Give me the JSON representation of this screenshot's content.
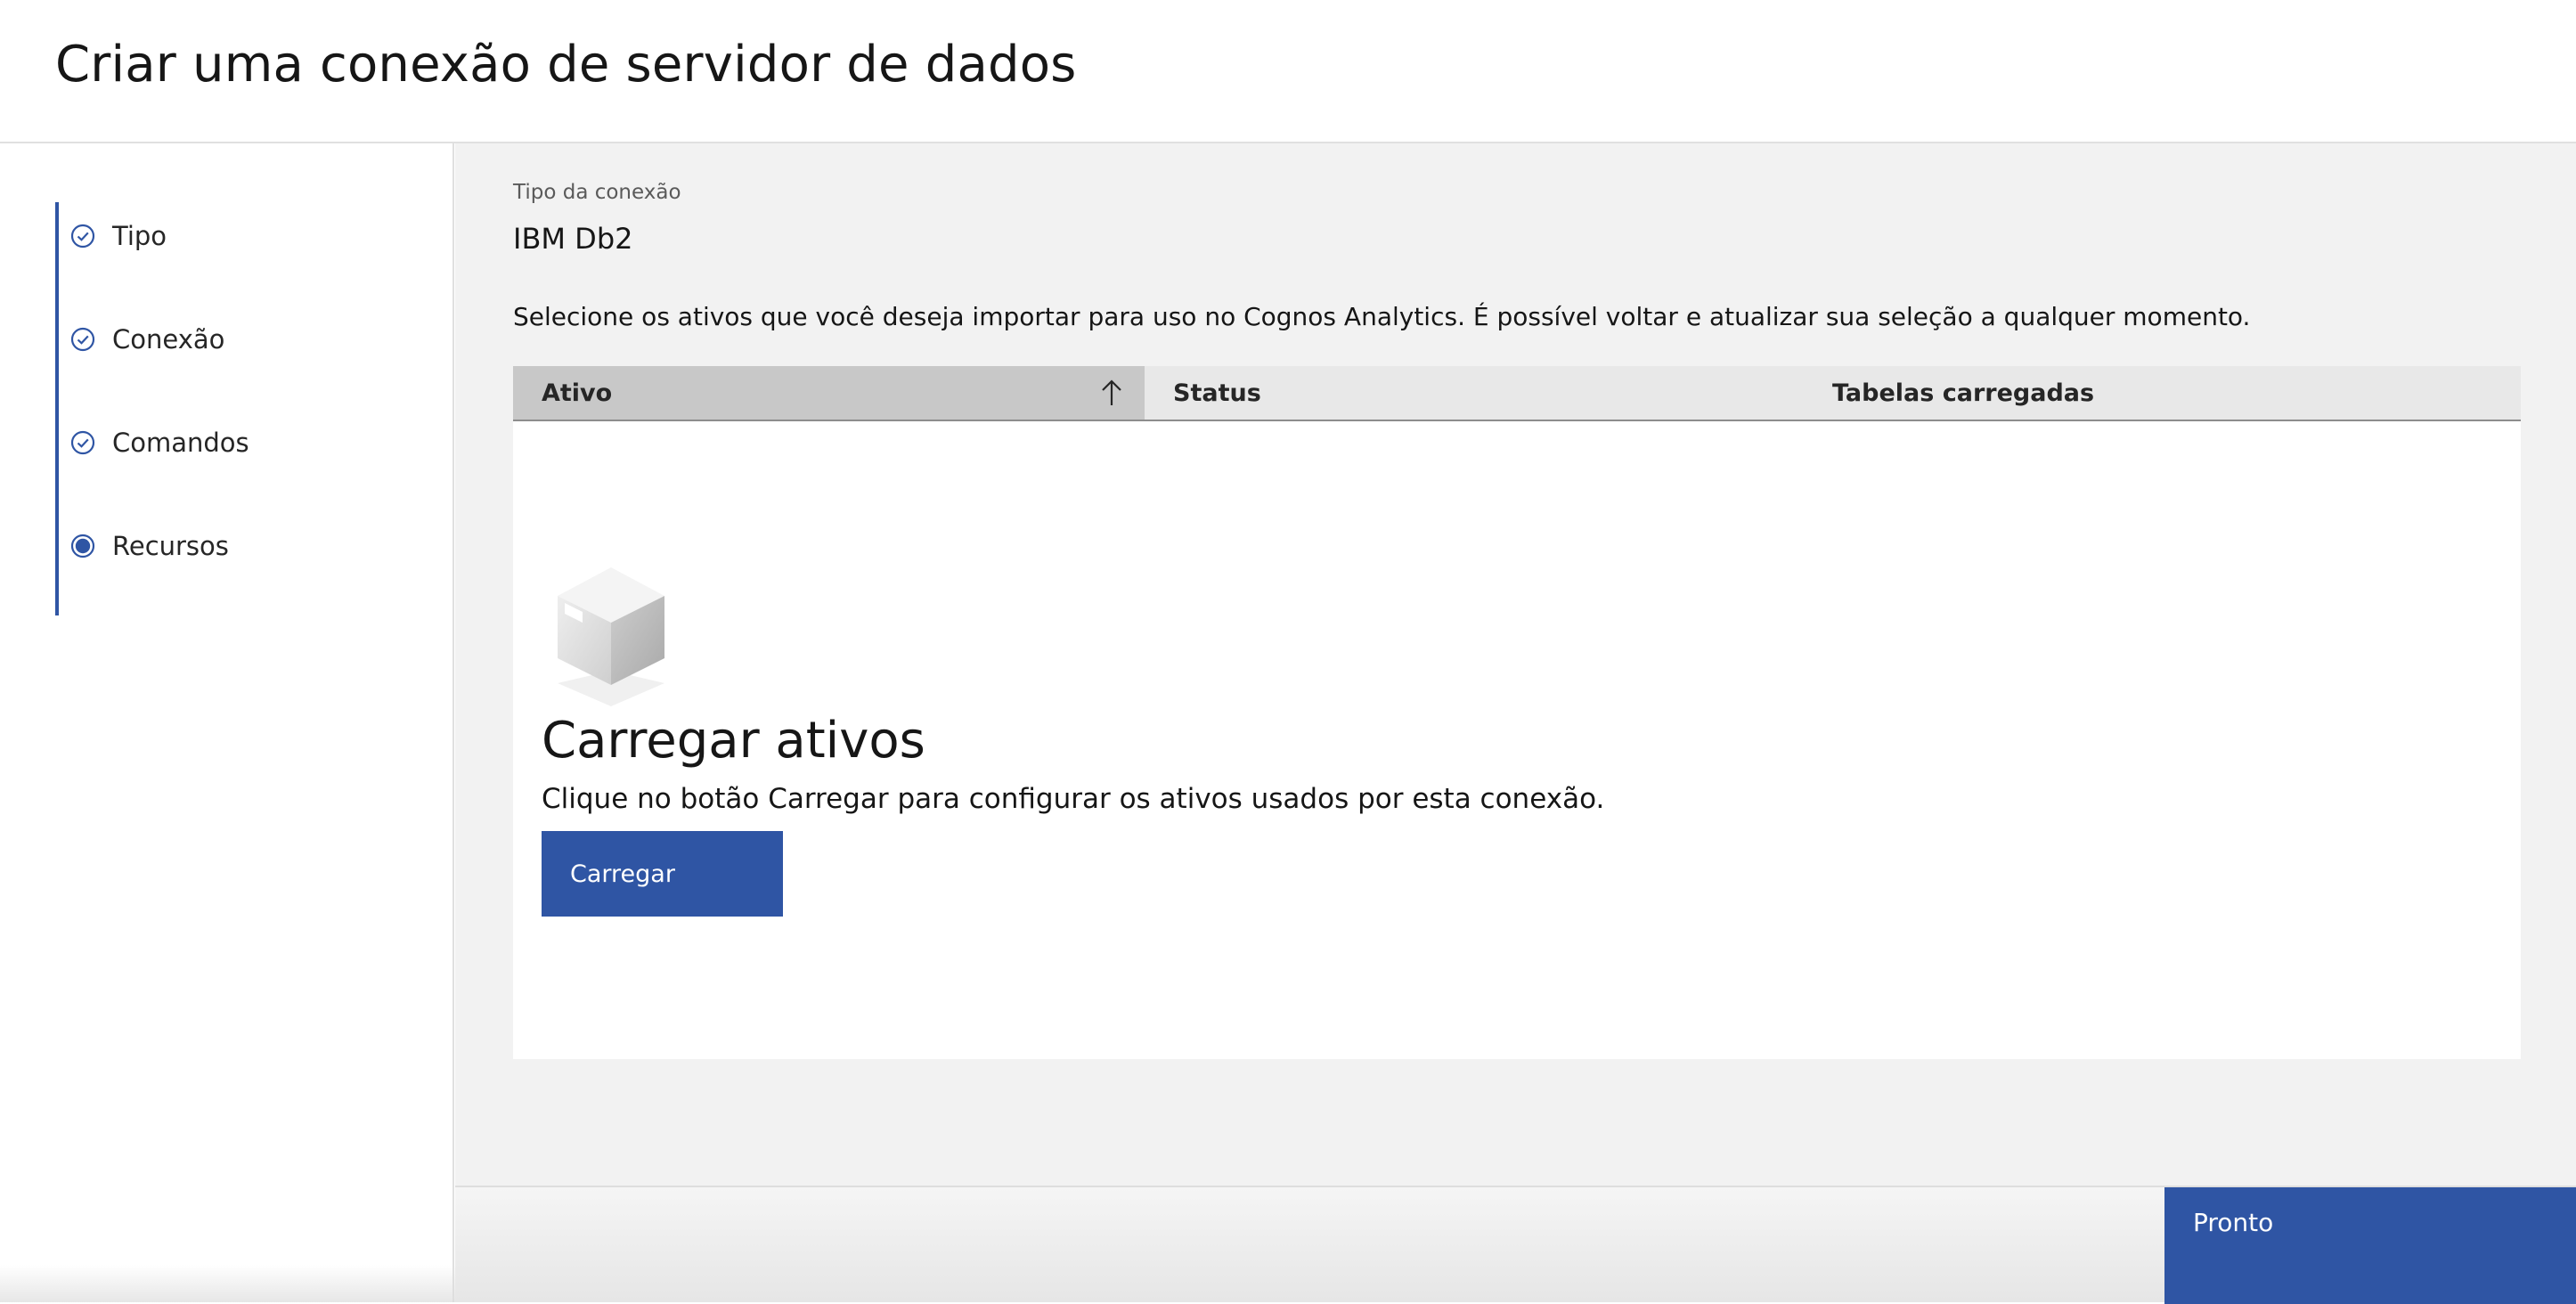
{
  "header": {
    "title": "Criar uma conexão de servidor de dados"
  },
  "stepper": {
    "accent_color": "#2f55a4",
    "steps": [
      {
        "label": "Tipo",
        "state": "complete",
        "icon": "checkmark-outline-icon"
      },
      {
        "label": "Conexão",
        "state": "complete",
        "icon": "checkmark-outline-icon"
      },
      {
        "label": "Comandos",
        "state": "complete",
        "icon": "checkmark-outline-icon"
      },
      {
        "label": "Recursos",
        "state": "current",
        "icon": "radio-current-icon"
      }
    ]
  },
  "main": {
    "connection_type_label": "Tipo da conexão",
    "connection_type_value": "IBM Db2",
    "instruction": "Selecione os ativos que você deseja importar para uso no Cognos Analytics. É possível voltar e atualizar sua seleção a qualquer momento.",
    "table": {
      "columns": [
        {
          "label": "Ativo",
          "sorted": "ascending"
        },
        {
          "label": "Status"
        },
        {
          "label": "Tabelas carregadas"
        }
      ],
      "rows": []
    },
    "empty_state": {
      "icon": "package-box-icon",
      "title": "Carregar ativos",
      "description": "Clique no botão Carregar para configurar os ativos usados por esta conexão.",
      "button_label": "Carregar"
    }
  },
  "footer": {
    "done_label": "Pronto",
    "button_color": "#2f55a4"
  }
}
